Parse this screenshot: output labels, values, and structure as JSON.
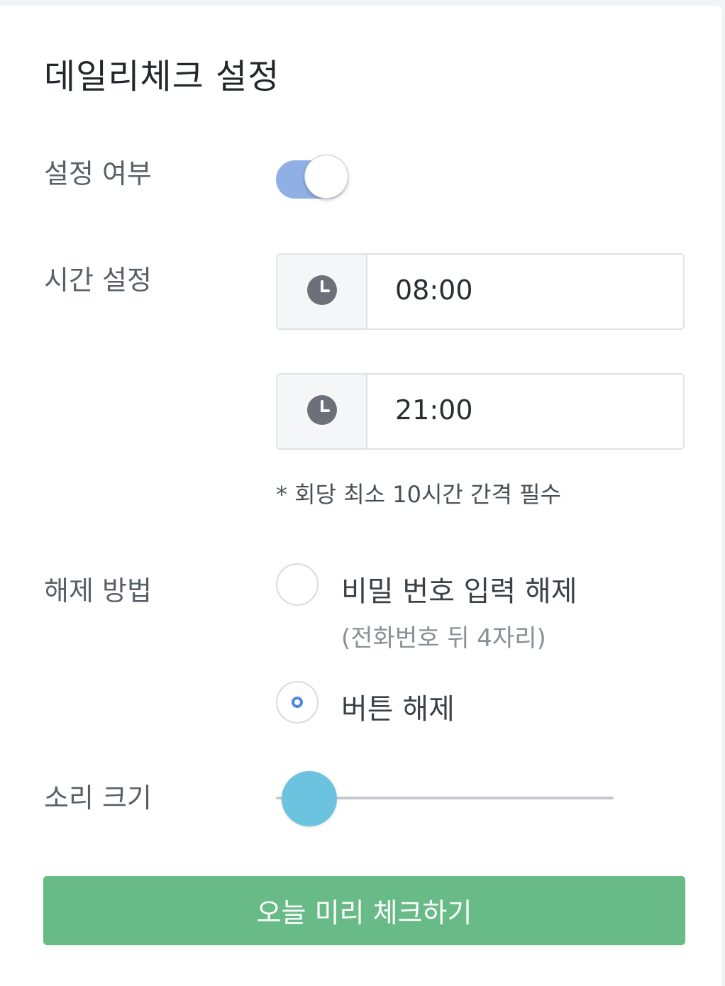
{
  "title": "데일리체크 설정",
  "labels": {
    "enable": "설정 여부",
    "time": "시간 설정",
    "unlock": "해제 방법",
    "volume": "소리 크기"
  },
  "toggle": {
    "on": true
  },
  "times": [
    {
      "value": "08:00",
      "icon": "clock-icon"
    },
    {
      "value": "21:00",
      "icon": "clock-icon"
    }
  ],
  "note": "* 회당 최소 10시간 간격 필수",
  "unlock_options": [
    {
      "label": "비밀 번호 입력 해제",
      "sub": "(전화번호 뒤 4자리)",
      "selected": false
    },
    {
      "label": "버튼 해제",
      "selected": true
    }
  ],
  "volume": {
    "level": 0.1
  },
  "button": {
    "label": "오늘 미리 체크하기"
  },
  "colors": {
    "toggle_track": "#8fb0e4",
    "slider_knob": "#6cc3e0",
    "button_bg": "#68bb86",
    "radio_accent": "#4e86e4"
  }
}
